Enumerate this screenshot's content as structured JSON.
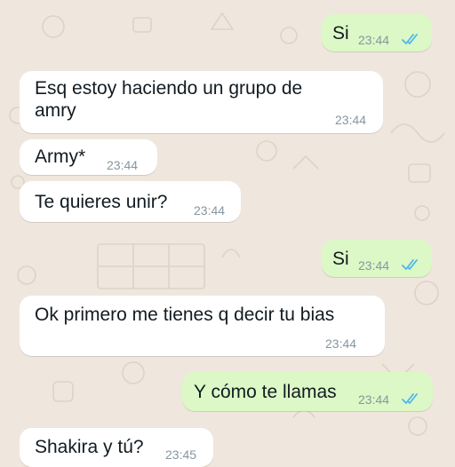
{
  "theme": {
    "wallpaper": "#efe7dd",
    "incoming_bubble": "#ffffff",
    "outgoing_bubble": "#dcf8c6",
    "read_tick": "#4fb6ec",
    "time_color": "#8696a0"
  },
  "messages": [
    {
      "direction": "outgoing",
      "line1": "Si",
      "line2": "",
      "time": "23:44",
      "status": "read-double-tick-icon"
    },
    {
      "direction": "incoming",
      "line1": "Esq estoy haciendo un grupo de",
      "line2": "amry",
      "time": "23:44"
    },
    {
      "direction": "incoming",
      "line1": "Army*",
      "line2": "",
      "time": "23:44"
    },
    {
      "direction": "incoming",
      "line1": "Te quieres unir?",
      "line2": "",
      "time": "23:44"
    },
    {
      "direction": "outgoing",
      "line1": "Si",
      "line2": "",
      "time": "23:44",
      "status": "read-double-tick-icon"
    },
    {
      "direction": "incoming",
      "line1": "Ok primero me tienes q decir tu bias",
      "line2": "",
      "time": "23:44"
    },
    {
      "direction": "outgoing",
      "line1": "Y cómo te llamas",
      "line2": "",
      "time": "23:44",
      "status": "read-double-tick-icon"
    },
    {
      "direction": "incoming",
      "line1": "Shakira y tú?",
      "line2": "",
      "time": "23:45"
    }
  ]
}
